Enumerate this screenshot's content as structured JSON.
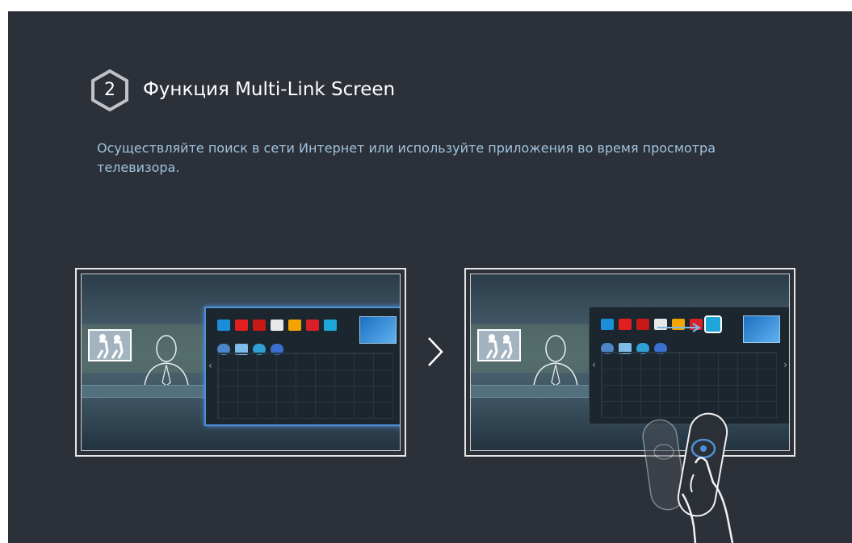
{
  "step": {
    "number": "2",
    "title": "Функция Multi-Link Screen"
  },
  "description": "Осуществляйте поиск в сети Интернет или используйте приложения во время просмотра телевизора.",
  "illustrations": [
    {
      "name": "tv-with-apps-panel-selected",
      "panel_state": "selected"
    },
    {
      "name": "tv-with-app-being-chosen",
      "panel_state": "app-highlighted"
    }
  ],
  "icons": [
    "hexagon-badge-icon",
    "chevron-right-icon",
    "remote-control-icon"
  ],
  "colors": {
    "background": "#2c3038",
    "title": "#ffffff",
    "description": "#9ec4e0",
    "selection": "#4f8fd8"
  }
}
